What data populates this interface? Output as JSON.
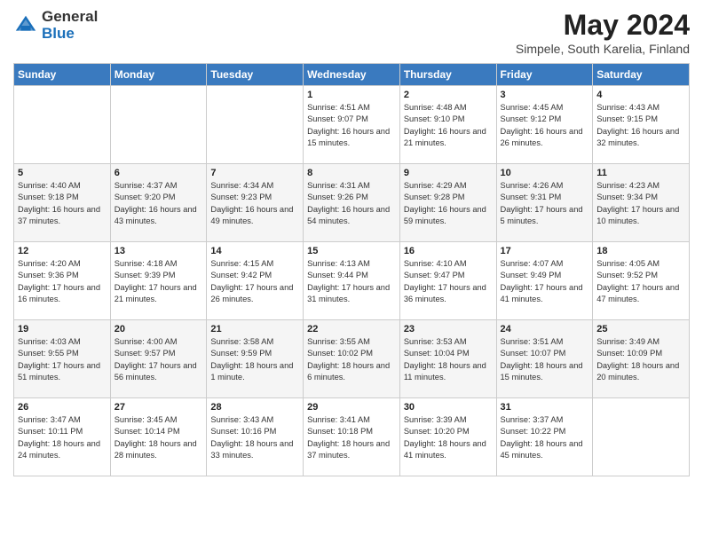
{
  "header": {
    "logo_general": "General",
    "logo_blue": "Blue",
    "title": "May 2024",
    "subtitle": "Simpele, South Karelia, Finland"
  },
  "weekdays": [
    "Sunday",
    "Monday",
    "Tuesday",
    "Wednesday",
    "Thursday",
    "Friday",
    "Saturday"
  ],
  "weeks": [
    [
      {
        "day": "",
        "sunrise": "",
        "sunset": "",
        "daylight": ""
      },
      {
        "day": "",
        "sunrise": "",
        "sunset": "",
        "daylight": ""
      },
      {
        "day": "",
        "sunrise": "",
        "sunset": "",
        "daylight": ""
      },
      {
        "day": "1",
        "sunrise": "Sunrise: 4:51 AM",
        "sunset": "Sunset: 9:07 PM",
        "daylight": "Daylight: 16 hours and 15 minutes."
      },
      {
        "day": "2",
        "sunrise": "Sunrise: 4:48 AM",
        "sunset": "Sunset: 9:10 PM",
        "daylight": "Daylight: 16 hours and 21 minutes."
      },
      {
        "day": "3",
        "sunrise": "Sunrise: 4:45 AM",
        "sunset": "Sunset: 9:12 PM",
        "daylight": "Daylight: 16 hours and 26 minutes."
      },
      {
        "day": "4",
        "sunrise": "Sunrise: 4:43 AM",
        "sunset": "Sunset: 9:15 PM",
        "daylight": "Daylight: 16 hours and 32 minutes."
      }
    ],
    [
      {
        "day": "5",
        "sunrise": "Sunrise: 4:40 AM",
        "sunset": "Sunset: 9:18 PM",
        "daylight": "Daylight: 16 hours and 37 minutes."
      },
      {
        "day": "6",
        "sunrise": "Sunrise: 4:37 AM",
        "sunset": "Sunset: 9:20 PM",
        "daylight": "Daylight: 16 hours and 43 minutes."
      },
      {
        "day": "7",
        "sunrise": "Sunrise: 4:34 AM",
        "sunset": "Sunset: 9:23 PM",
        "daylight": "Daylight: 16 hours and 49 minutes."
      },
      {
        "day": "8",
        "sunrise": "Sunrise: 4:31 AM",
        "sunset": "Sunset: 9:26 PM",
        "daylight": "Daylight: 16 hours and 54 minutes."
      },
      {
        "day": "9",
        "sunrise": "Sunrise: 4:29 AM",
        "sunset": "Sunset: 9:28 PM",
        "daylight": "Daylight: 16 hours and 59 minutes."
      },
      {
        "day": "10",
        "sunrise": "Sunrise: 4:26 AM",
        "sunset": "Sunset: 9:31 PM",
        "daylight": "Daylight: 17 hours and 5 minutes."
      },
      {
        "day": "11",
        "sunrise": "Sunrise: 4:23 AM",
        "sunset": "Sunset: 9:34 PM",
        "daylight": "Daylight: 17 hours and 10 minutes."
      }
    ],
    [
      {
        "day": "12",
        "sunrise": "Sunrise: 4:20 AM",
        "sunset": "Sunset: 9:36 PM",
        "daylight": "Daylight: 17 hours and 16 minutes."
      },
      {
        "day": "13",
        "sunrise": "Sunrise: 4:18 AM",
        "sunset": "Sunset: 9:39 PM",
        "daylight": "Daylight: 17 hours and 21 minutes."
      },
      {
        "day": "14",
        "sunrise": "Sunrise: 4:15 AM",
        "sunset": "Sunset: 9:42 PM",
        "daylight": "Daylight: 17 hours and 26 minutes."
      },
      {
        "day": "15",
        "sunrise": "Sunrise: 4:13 AM",
        "sunset": "Sunset: 9:44 PM",
        "daylight": "Daylight: 17 hours and 31 minutes."
      },
      {
        "day": "16",
        "sunrise": "Sunrise: 4:10 AM",
        "sunset": "Sunset: 9:47 PM",
        "daylight": "Daylight: 17 hours and 36 minutes."
      },
      {
        "day": "17",
        "sunrise": "Sunrise: 4:07 AM",
        "sunset": "Sunset: 9:49 PM",
        "daylight": "Daylight: 17 hours and 41 minutes."
      },
      {
        "day": "18",
        "sunrise": "Sunrise: 4:05 AM",
        "sunset": "Sunset: 9:52 PM",
        "daylight": "Daylight: 17 hours and 47 minutes."
      }
    ],
    [
      {
        "day": "19",
        "sunrise": "Sunrise: 4:03 AM",
        "sunset": "Sunset: 9:55 PM",
        "daylight": "Daylight: 17 hours and 51 minutes."
      },
      {
        "day": "20",
        "sunrise": "Sunrise: 4:00 AM",
        "sunset": "Sunset: 9:57 PM",
        "daylight": "Daylight: 17 hours and 56 minutes."
      },
      {
        "day": "21",
        "sunrise": "Sunrise: 3:58 AM",
        "sunset": "Sunset: 9:59 PM",
        "daylight": "Daylight: 18 hours and 1 minute."
      },
      {
        "day": "22",
        "sunrise": "Sunrise: 3:55 AM",
        "sunset": "Sunset: 10:02 PM",
        "daylight": "Daylight: 18 hours and 6 minutes."
      },
      {
        "day": "23",
        "sunrise": "Sunrise: 3:53 AM",
        "sunset": "Sunset: 10:04 PM",
        "daylight": "Daylight: 18 hours and 11 minutes."
      },
      {
        "day": "24",
        "sunrise": "Sunrise: 3:51 AM",
        "sunset": "Sunset: 10:07 PM",
        "daylight": "Daylight: 18 hours and 15 minutes."
      },
      {
        "day": "25",
        "sunrise": "Sunrise: 3:49 AM",
        "sunset": "Sunset: 10:09 PM",
        "daylight": "Daylight: 18 hours and 20 minutes."
      }
    ],
    [
      {
        "day": "26",
        "sunrise": "Sunrise: 3:47 AM",
        "sunset": "Sunset: 10:11 PM",
        "daylight": "Daylight: 18 hours and 24 minutes."
      },
      {
        "day": "27",
        "sunrise": "Sunrise: 3:45 AM",
        "sunset": "Sunset: 10:14 PM",
        "daylight": "Daylight: 18 hours and 28 minutes."
      },
      {
        "day": "28",
        "sunrise": "Sunrise: 3:43 AM",
        "sunset": "Sunset: 10:16 PM",
        "daylight": "Daylight: 18 hours and 33 minutes."
      },
      {
        "day": "29",
        "sunrise": "Sunrise: 3:41 AM",
        "sunset": "Sunset: 10:18 PM",
        "daylight": "Daylight: 18 hours and 37 minutes."
      },
      {
        "day": "30",
        "sunrise": "Sunrise: 3:39 AM",
        "sunset": "Sunset: 10:20 PM",
        "daylight": "Daylight: 18 hours and 41 minutes."
      },
      {
        "day": "31",
        "sunrise": "Sunrise: 3:37 AM",
        "sunset": "Sunset: 10:22 PM",
        "daylight": "Daylight: 18 hours and 45 minutes."
      },
      {
        "day": "",
        "sunrise": "",
        "sunset": "",
        "daylight": ""
      }
    ]
  ]
}
